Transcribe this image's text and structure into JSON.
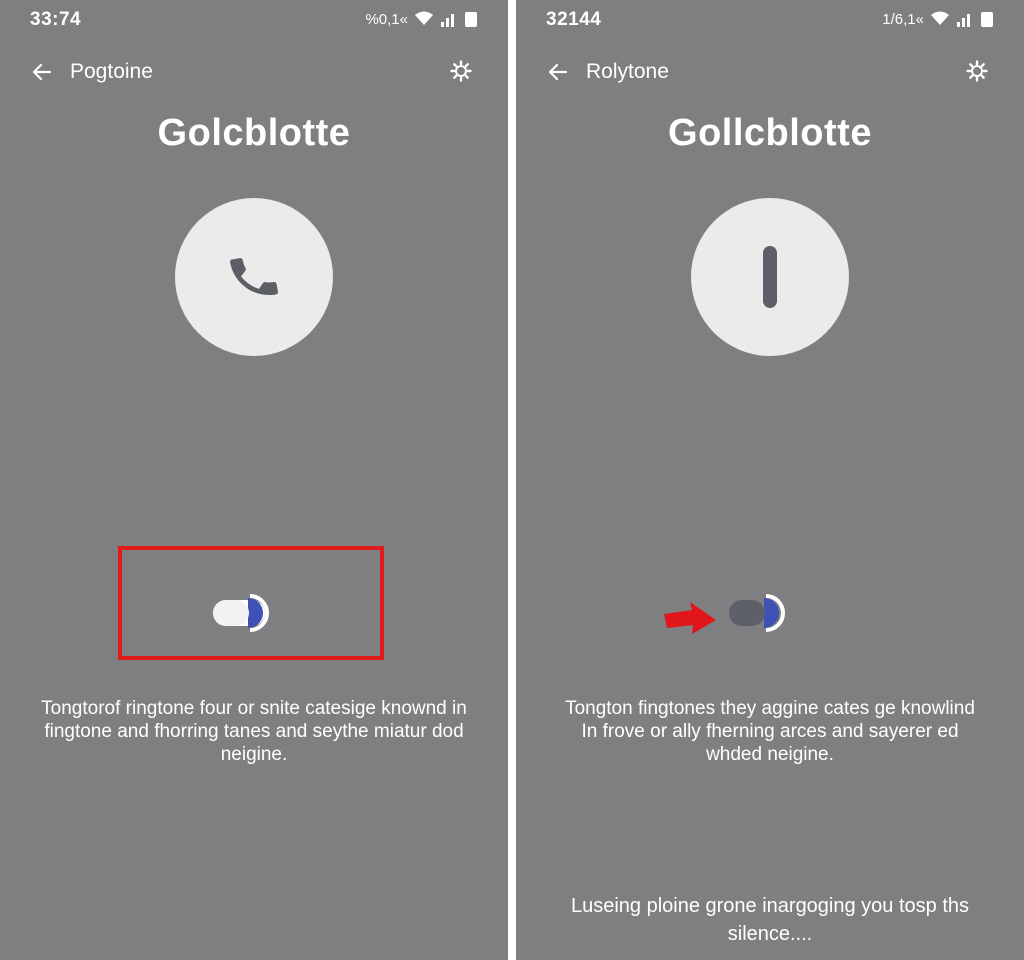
{
  "left": {
    "status": {
      "time": "33:74",
      "right_text": "%0,1«"
    },
    "top_bar": {
      "title": "Pogtoine"
    },
    "page_title": "Golcblotte",
    "description": "Tongtorof ringtone four or snite catesige knownd in fingtone and fhorring tanes and seythe miatur dod neigine.",
    "toggle_state": "on"
  },
  "right": {
    "status": {
      "time": "32144",
      "right_text": "1/6,1«"
    },
    "top_bar": {
      "title": "Rolytone"
    },
    "page_title": "Gollcblotte",
    "description": "Tongton fingtones they aggine cates ge knowlind In frove or ally fherning arces and sayerer ed whded neigine.",
    "footer_text": "Luseing ploine grone inargoging you tosp ths silence....",
    "toggle_state": "off"
  },
  "colors": {
    "panel_bg": "#7f7f82",
    "circle_bg": "#ebebeb",
    "accent_blue": "#3f51b5",
    "highlight_red": "#e01919",
    "arrow_red": "#e0161a"
  },
  "icons": {
    "back": "arrow-left-icon",
    "settings": "gear-icon",
    "phone": "phone-icon",
    "wifi": "wifi-icon",
    "signal": "signal-icon",
    "battery": "battery-icon",
    "pointer": "red-arrow-icon"
  }
}
